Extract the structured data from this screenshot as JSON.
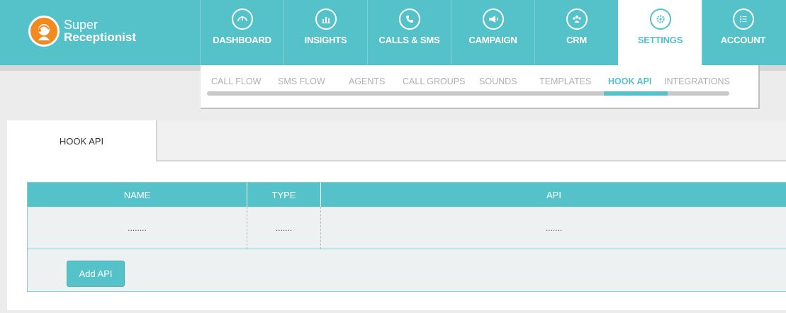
{
  "brand": {
    "line1": "Super",
    "line2": "Receptionist",
    "accent": "#55c1c8",
    "logo_color": "#f28a1f"
  },
  "nav": [
    {
      "key": "dashboard",
      "label": "DASHBOARD",
      "icon": "gauge-icon"
    },
    {
      "key": "insights",
      "label": "INSIGHTS",
      "icon": "bar-chart-icon"
    },
    {
      "key": "calls-sms",
      "label": "CALLS & SMS",
      "icon": "phone-icon"
    },
    {
      "key": "campaign",
      "label": "CAMPAIGN",
      "icon": "megaphone-icon"
    },
    {
      "key": "crm",
      "label": "CRM",
      "icon": "users-icon"
    },
    {
      "key": "settings",
      "label": "SETTINGS",
      "icon": "gear-icon",
      "active": true
    },
    {
      "key": "account",
      "label": "ACCOUNT",
      "icon": "list-icon"
    }
  ],
  "subnav": {
    "items": [
      "CALL FLOW",
      "SMS FLOW",
      "AGENTS",
      "CALL GROUPS",
      "SOUNDS",
      "TEMPLATES",
      "HOOK API",
      "INTEGRATIONS"
    ],
    "active": "HOOK API"
  },
  "panel": {
    "tab_label": "HOOK API",
    "table": {
      "headers": {
        "name": "NAME",
        "type": "TYPE",
        "api": "API"
      },
      "rows": [
        {
          "name": "........",
          "type": ".......",
          "api": "......."
        }
      ]
    },
    "add_button": "Add API"
  }
}
